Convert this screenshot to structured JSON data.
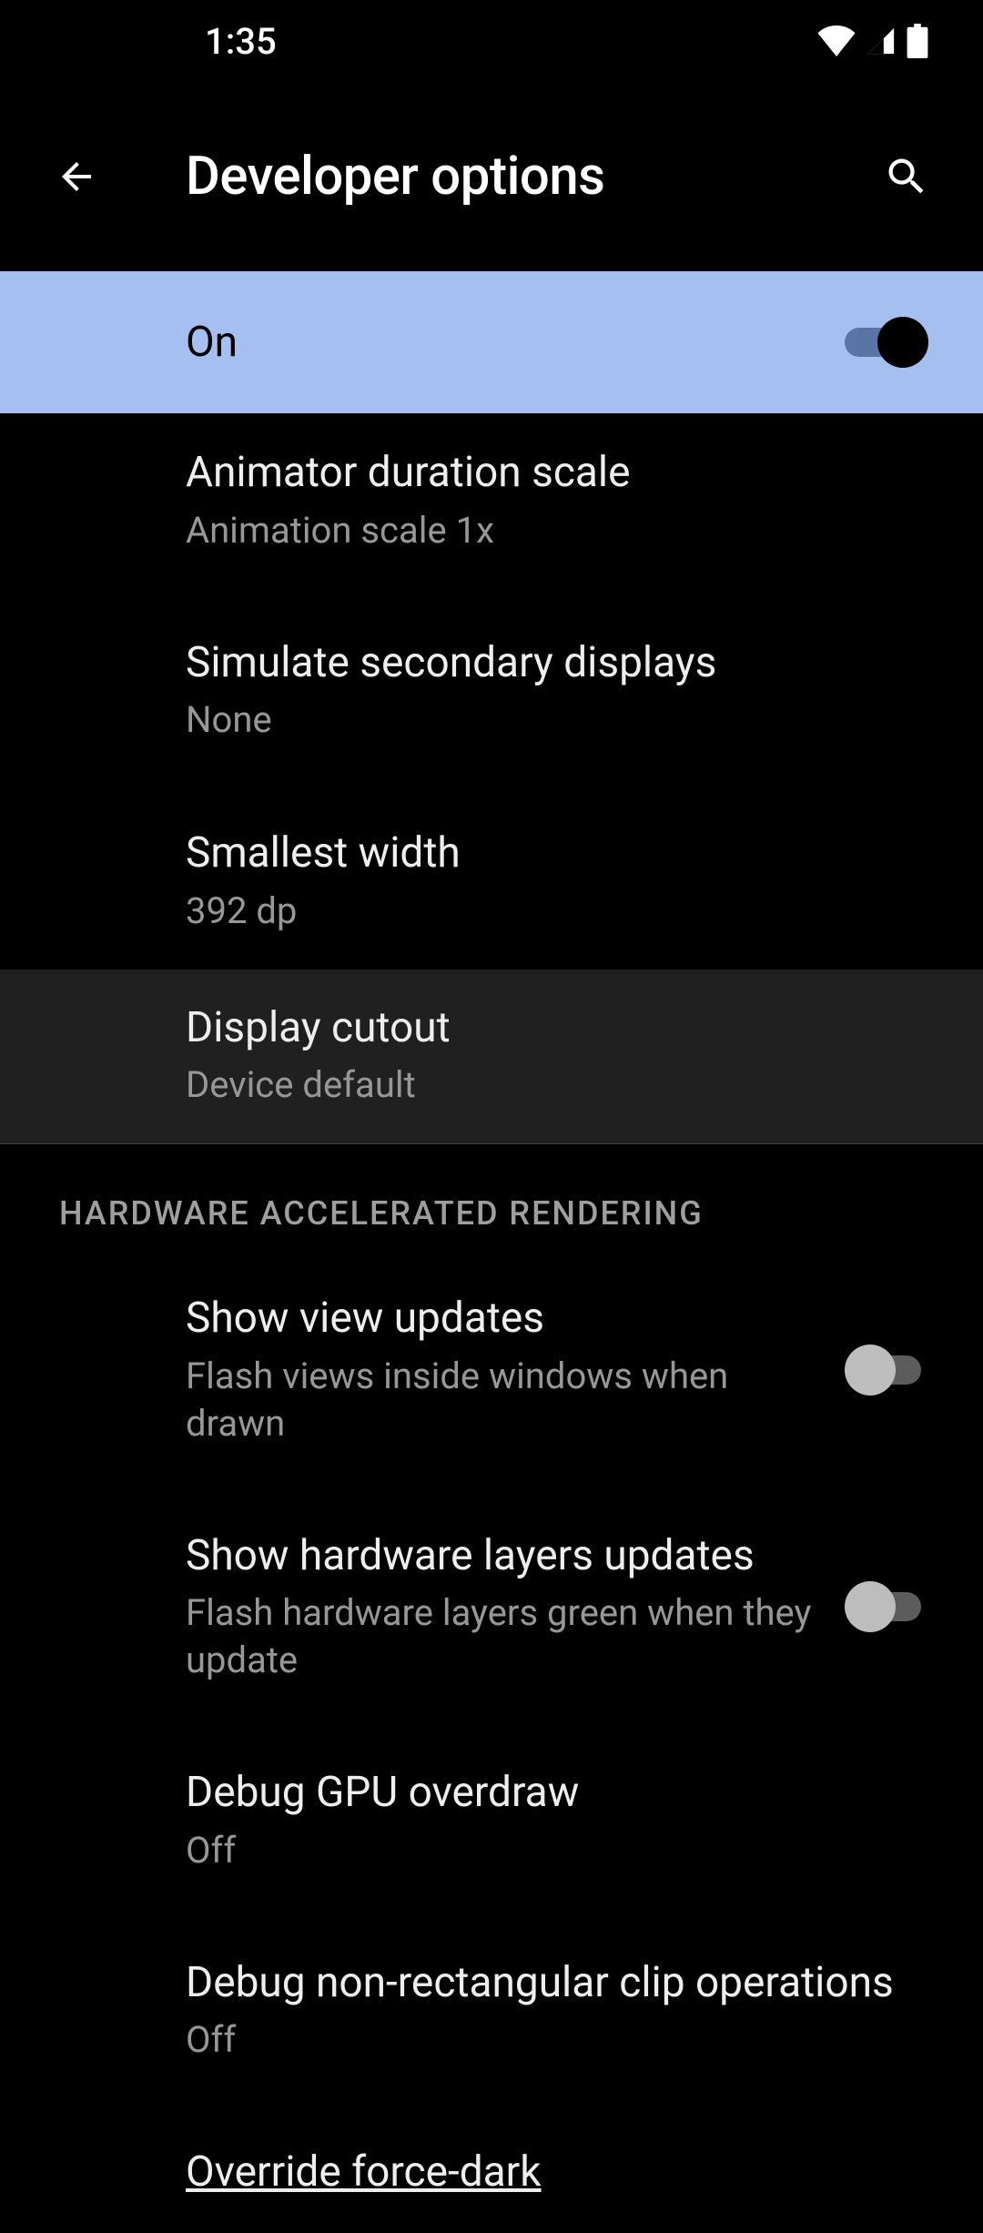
{
  "status_bar": {
    "time": "1:35"
  },
  "app_bar": {
    "title": "Developer options"
  },
  "master_toggle": {
    "label": "On",
    "value": true
  },
  "settings": [
    {
      "title": "Animator duration scale",
      "subtitle": "Animation scale 1x"
    },
    {
      "title": "Simulate secondary displays",
      "subtitle": "None"
    },
    {
      "title": "Smallest width",
      "subtitle": "392 dp"
    },
    {
      "title": "Display cutout",
      "subtitle": "Device default",
      "highlighted": true
    }
  ],
  "section_header": "HARDWARE ACCELERATED RENDERING",
  "hw_settings": [
    {
      "title": "Show view updates",
      "subtitle": "Flash views inside windows when drawn",
      "toggle": false
    },
    {
      "title": "Show hardware layers updates",
      "subtitle": "Flash hardware layers green when they update",
      "toggle": false
    },
    {
      "title": "Debug GPU overdraw",
      "subtitle": "Off"
    },
    {
      "title": "Debug non-rectangular clip operations",
      "subtitle": "Off"
    },
    {
      "title": "Override force-dark"
    }
  ]
}
